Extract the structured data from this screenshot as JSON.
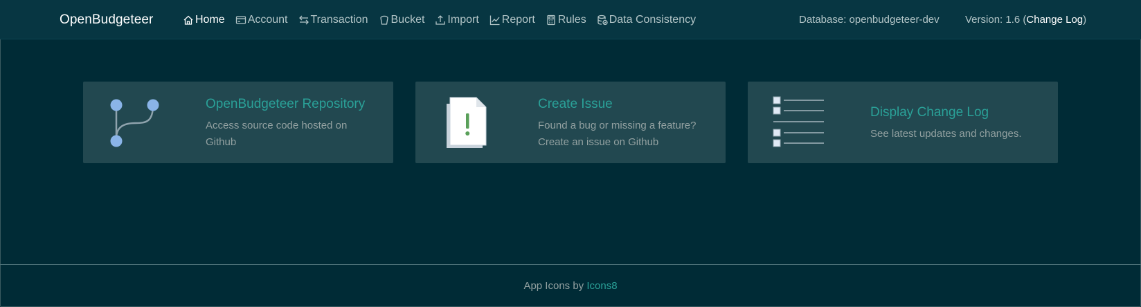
{
  "app": {
    "brand": "OpenBudgeteer"
  },
  "nav": {
    "items": [
      {
        "label": "Home",
        "icon": "home-icon",
        "active": true
      },
      {
        "label": "Account",
        "icon": "credit-card-icon"
      },
      {
        "label": "Transaction",
        "icon": "arrows-exchange-icon"
      },
      {
        "label": "Bucket",
        "icon": "bucket-icon"
      },
      {
        "label": "Import",
        "icon": "upload-icon"
      },
      {
        "label": "Report",
        "icon": "graph-icon"
      },
      {
        "label": "Rules",
        "icon": "calculator-icon"
      },
      {
        "label": "Data Consistency",
        "icon": "database-check-icon"
      }
    ]
  },
  "header": {
    "database": "Database: openbudgeteer-dev",
    "version_prefix": "Version: 1.6 (",
    "changelog_link": "Change Log",
    "version_suffix": ")"
  },
  "cards": [
    {
      "title": "OpenBudgeteer Repository",
      "line1": "Access source code hosted on",
      "line2": "Github",
      "icon": "git-branch-icon"
    },
    {
      "title": "Create Issue",
      "line1": "Found a bug or missing a feature?",
      "line2": "Create an issue on Github",
      "icon": "document-exclamation-icon"
    },
    {
      "title": "Display Change Log",
      "line1": "See latest updates and changes.",
      "icon": "checklist-icon"
    }
  ],
  "footer": {
    "text": "App Icons by ",
    "link": "Icons8"
  },
  "colors": {
    "background": "#002b36",
    "navbar": "#073642",
    "card": "#224850",
    "accent": "#2aa198"
  }
}
